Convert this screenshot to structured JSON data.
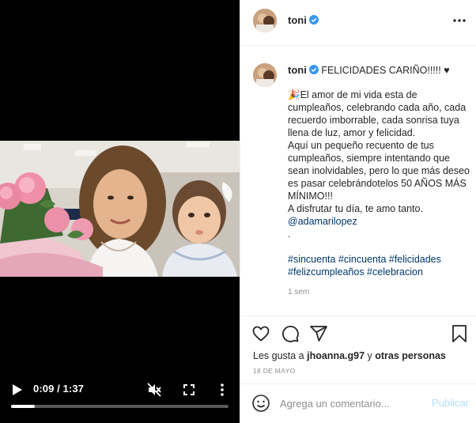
{
  "video": {
    "time_display": "0:09 / 1:37",
    "progress_fraction": 0.11
  },
  "post": {
    "username": "toni",
    "caption_title": "FELICIDADES CARIÑO!!!!! ♥",
    "caption_emoji": "🎉",
    "caption_text": "El amor de mi vida esta de cumpleaños, celebrando cada año, cada recuerdo imborrable, cada sonrisa tuya llena de luz, amor y felicidad.\nAquí un pequeño recuento de tus cumpleaños, siempre intentando que sean inolvidables, pero lo que más deseo es pasar celebrándotelos 50 AÑOS MÁS MÍNIMO!!!\nA disfrutar tu día, te amo tanto.",
    "mention": "@adamarilopez",
    "dot": ".",
    "hashtags_line1": "#sincuenta #cincuenta #felicidades",
    "hashtags_line2": "#felizcumpleaños #celebracion",
    "caption_time": "1 sem",
    "likes_prefix": "Les gusta a ",
    "likes_user": "jhoanna.g97",
    "likes_middle": " y ",
    "likes_others": "otras personas",
    "date": "18 DE MAYO"
  },
  "comment": {
    "placeholder": "Agrega un comentario...",
    "post_label": "Publicar"
  },
  "icons": {
    "play": "play-icon",
    "mute": "volume-muted-icon",
    "fullscreen": "fullscreen-icon",
    "more": "more-vertical-icon",
    "verified": "verified-badge-icon",
    "like": "heart-icon",
    "comment": "comment-bubble-icon",
    "share": "paper-plane-icon",
    "save": "bookmark-icon",
    "emoji": "smiley-icon"
  },
  "colors": {
    "verified_blue": "#3897f0",
    "link": "#00376b",
    "muted_text": "#8e8e8e",
    "post_disabled": "#b2dffc"
  }
}
